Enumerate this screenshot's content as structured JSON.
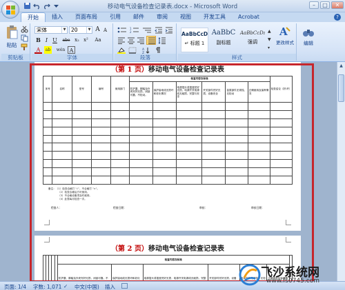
{
  "window": {
    "title": "移动电气设备检查记录表.docx - Microsoft Word",
    "controls": [
      "–",
      "□",
      "✕"
    ]
  },
  "tabs": [
    "开始",
    "插入",
    "页面布局",
    "引用",
    "邮件",
    "审阅",
    "视图",
    "开发工具",
    "Acrobat"
  ],
  "active_tab": "开始",
  "ribbon": {
    "clipboard": {
      "paste_label": "粘贴",
      "group_label": "剪贴板"
    },
    "font": {
      "font_name": "宋体",
      "font_size": "20",
      "group_label": "字体",
      "bold": "B",
      "italic": "I",
      "underline": "U",
      "strike": "abe",
      "subscript": "x₂",
      "superscript": "x²",
      "clear": "Aa",
      "color": "A",
      "grow": "A",
      "shrink": "A",
      "wen": "wén",
      "char_border": "A"
    },
    "paragraph": {
      "group_label": "段落"
    },
    "styles": {
      "group_label": "样式",
      "items": [
        {
          "sample": "AaBbCcD",
          "name": "↵ 标题 1"
        },
        {
          "sample": "AaBbC",
          "name": "副标题"
        },
        {
          "sample": "AaBbCcDı",
          "name": "强调"
        }
      ],
      "change_styles": "更改样式",
      "edit": "编辑"
    },
    "accent_color": "#c5d9f1"
  },
  "document": {
    "page1": {
      "title_prefix": "（第 1 页）",
      "title_text": "移动电气设备检查记录表",
      "table": {
        "super_header": "检查内容及标准",
        "headers": [
          "序号",
          "名称",
          "型号",
          "编号",
          "使用部门",
          "防护罩、脚踏及外壳完好无损，闭锁可靠，不松动。",
          "保护接地线无损坏和老化情况",
          "电源插头或插座完好无损，电源开关电源线无破损，完整与安全",
          "开关部件完好无损，设备安全",
          "金属部件无锈蚀、无松动",
          "正确使用及保养情况",
          "检查结论（好/坏）"
        ],
        "empty_rows": 10
      },
      "notes": [
        "备注：（1）检查合格打 \"√\"，不合格打 \"×\"。",
        "（2）检查合格后方可使用。",
        "（3）不合格设备须及时维修。",
        "（4）此表每月检查一次。"
      ],
      "signatures": [
        "检查人：",
        "检查日期：",
        "审核：",
        "审核日期："
      ]
    },
    "page2": {
      "title_prefix": "（第 2 页）",
      "title_text": "移动电气设备检查记录表",
      "super_header": "检查内容及标准"
    }
  },
  "statusbar": {
    "page": "页面: 1/4",
    "words": "字数: 1,071",
    "language": "中文(中国)",
    "mode": "插入"
  },
  "watermark": {
    "brand": "飞沙系统网",
    "url": "www.fs0745.com"
  }
}
